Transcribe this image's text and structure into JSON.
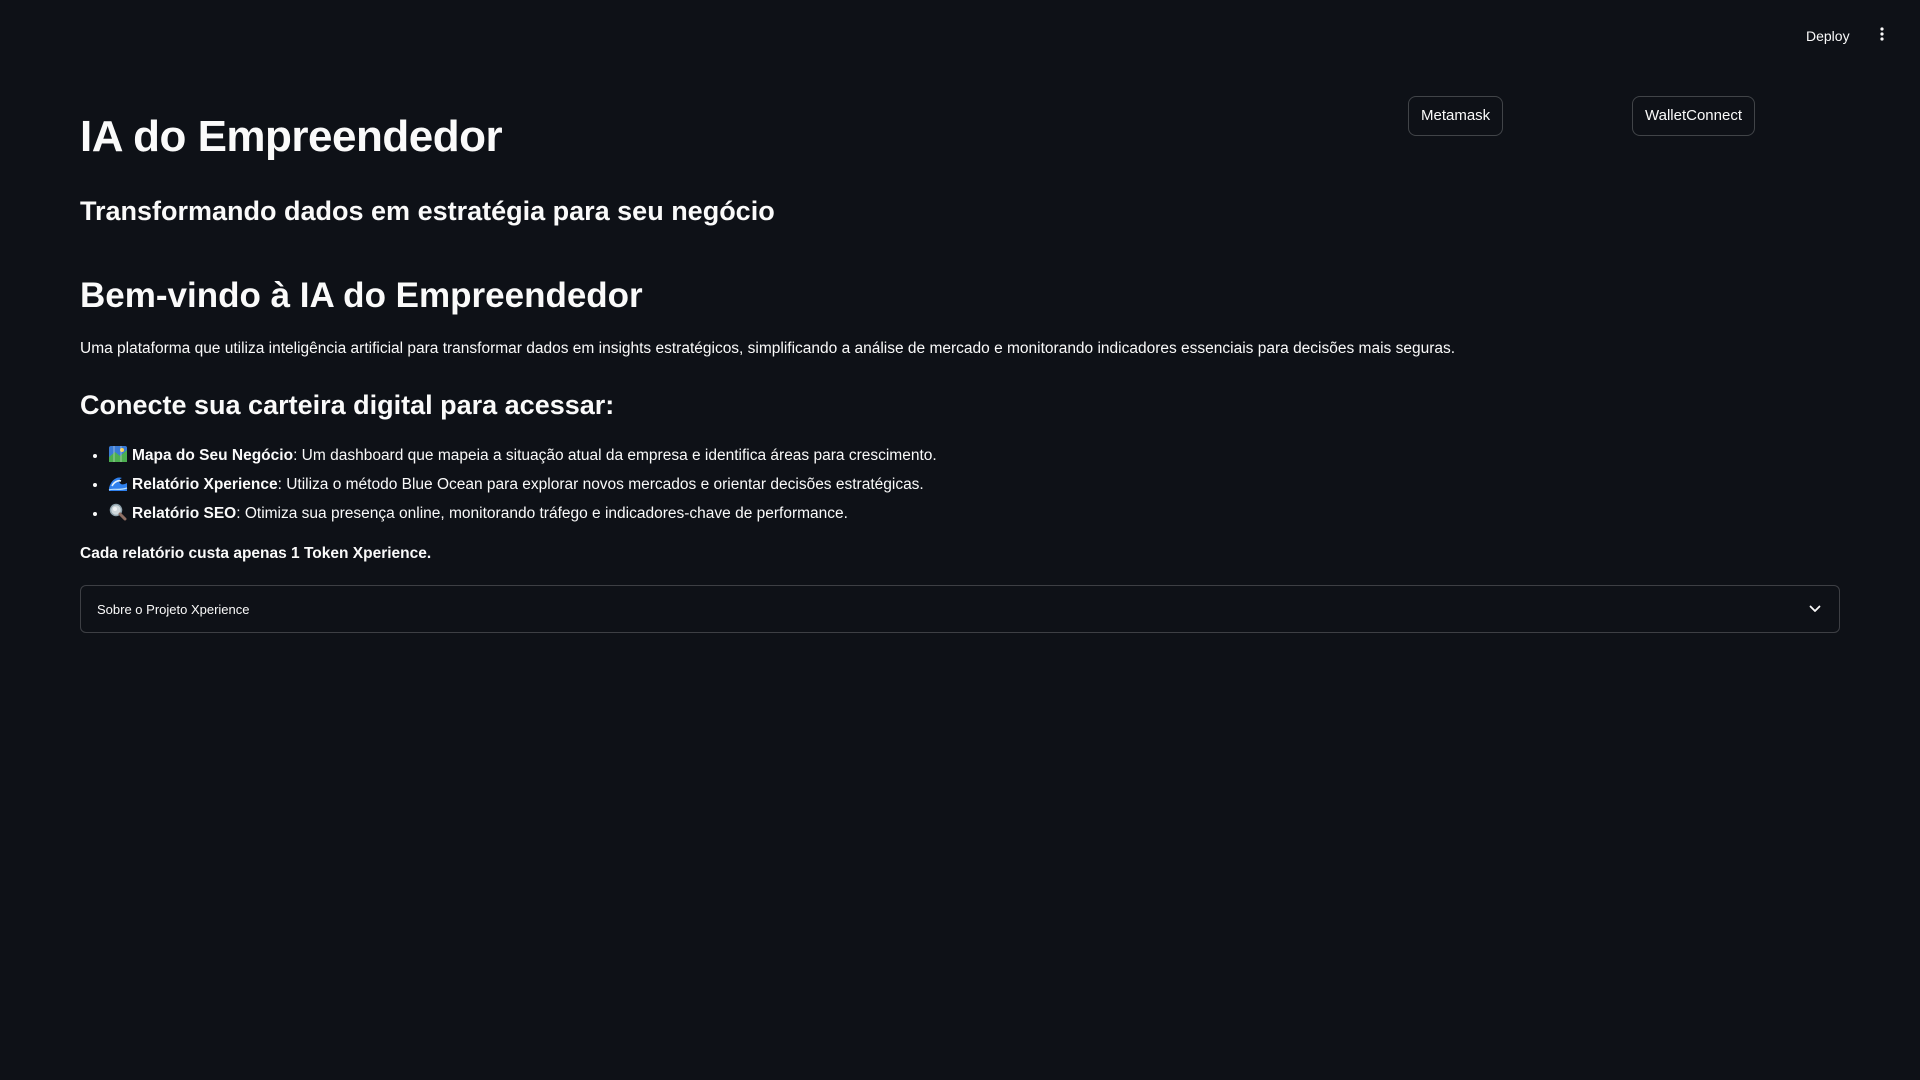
{
  "header": {
    "deploy_label": "Deploy",
    "menu_icon": "vertical-ellipsis-icon"
  },
  "wallets": {
    "metamask_label": "Metamask",
    "walletconnect_label": "WalletConnect"
  },
  "main": {
    "title": "IA do Empreendedor",
    "subtitle": "Transformando dados em estratégia para seu negócio",
    "welcome_heading": "Bem-vindo à IA do Empreendedor",
    "intro": "Uma plataforma que utiliza inteligência artificial para transformar dados em insights estratégicos, simplificando a análise de mercado e monitorando indicadores essenciais para decisões mais seguras.",
    "connect_heading": "Conecte sua carteira digital para acessar:",
    "features": [
      {
        "icon": "map-icon",
        "title": "Mapa do Seu Negócio",
        "description": ": Um dashboard que mapeia a situação atual da empresa e identifica áreas para crescimento."
      },
      {
        "icon": "wave-icon",
        "title": "Relatório Xperience",
        "description": ": Utiliza o método Blue Ocean para explorar novos mercados e orientar decisões estratégicas."
      },
      {
        "icon": "magnifying-glass-icon",
        "title": "Relatório SEO",
        "description": ": Otimiza sua presença online, monitorando tráfego e indicadores-chave de performance."
      }
    ],
    "cost_note": "Cada relatório custa apenas 1 Token Xperience.",
    "expander_label": "Sobre o Projeto Xperience",
    "expander_icon": "chevron-down-icon"
  },
  "colors": {
    "background": "#0e1117",
    "text": "#fafafa",
    "border": "#3d4048"
  }
}
